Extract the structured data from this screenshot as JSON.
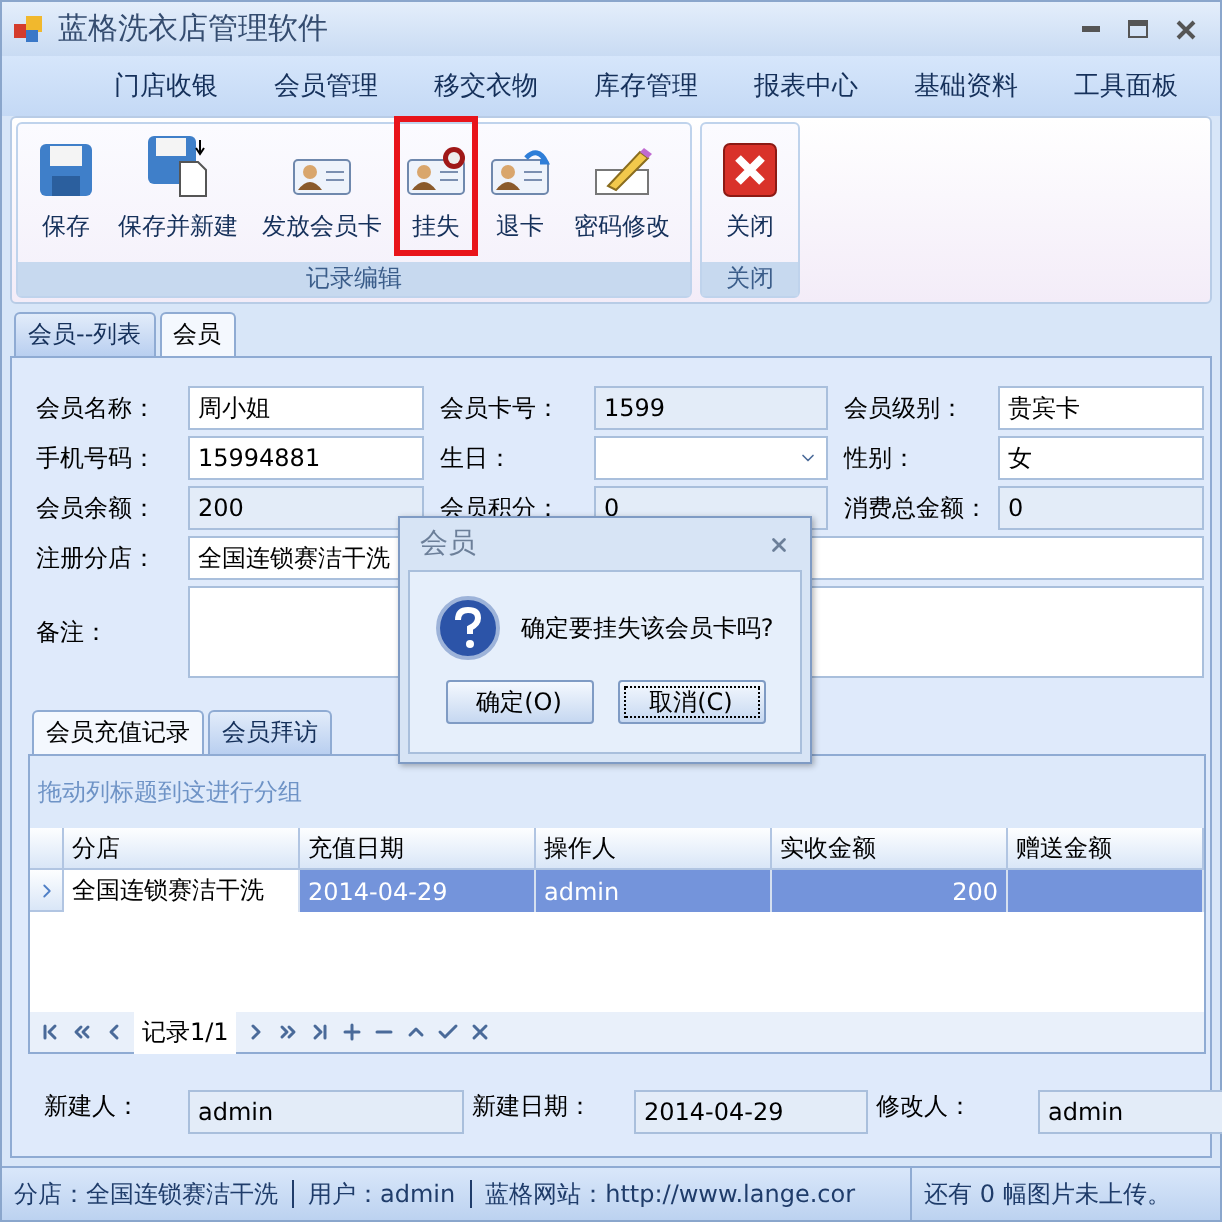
{
  "window": {
    "title": "蓝格洗衣店管理软件"
  },
  "menu": [
    "门店收银",
    "会员管理",
    "移交衣物",
    "库存管理",
    "报表中心",
    "基础资料",
    "工具面板"
  ],
  "ribbon": [
    {
      "label": "记录编辑",
      "buttons": [
        {
          "label": "保存",
          "kind": "save",
          "highlighted": false
        },
        {
          "label": "保存并新建",
          "kind": "save-new",
          "highlighted": false
        },
        {
          "label": "发放会员卡",
          "kind": "card",
          "highlighted": false
        },
        {
          "label": "挂失",
          "kind": "card-lost",
          "highlighted": true
        },
        {
          "label": "退卡",
          "kind": "card-return",
          "highlighted": false
        },
        {
          "label": "密码修改",
          "kind": "pencil",
          "highlighted": false
        }
      ]
    },
    {
      "label": "关闭",
      "buttons": [
        {
          "label": "关闭",
          "kind": "close",
          "highlighted": false
        }
      ]
    }
  ],
  "doc_tabs": [
    {
      "label": "会员--列表",
      "selected": false
    },
    {
      "label": "会员",
      "selected": true
    }
  ],
  "form": [
    {
      "label": "会员名称：",
      "value": "周小姐",
      "kind": "text",
      "readonly": false
    },
    {
      "label": "会员卡号：",
      "value": "1599",
      "kind": "text",
      "readonly": true
    },
    {
      "label": "会员级别：",
      "value": "贵宾卡",
      "kind": "text",
      "readonly": false
    },
    {
      "label": "手机号码：",
      "value": "15994881",
      "kind": "text",
      "readonly": false
    },
    {
      "label": "生日：",
      "kind": "dropdown",
      "readonly": false
    },
    {
      "label": "性别：",
      "value": "女",
      "kind": "text",
      "readonly": false
    },
    {
      "label": "会员余额：",
      "value": "200",
      "kind": "text",
      "readonly": true
    },
    {
      "label": "会员积分：",
      "value": "0",
      "kind": "text",
      "readonly": true
    },
    {
      "label": "消费总金额：",
      "value": "0",
      "kind": "text",
      "readonly": true
    },
    {
      "label": "注册分店：",
      "value": "全国连锁赛洁干洗",
      "kind": "wide",
      "readonly": false
    },
    {
      "label": "备注：",
      "kind": "memo",
      "readonly": false
    }
  ],
  "detail_tabs": [
    {
      "label": "会员充值记录",
      "selected": true
    },
    {
      "label": "会员拜访",
      "selected": false
    }
  ],
  "grid": {
    "group_hint": "拖动列标题到这进行分组",
    "columns": [
      {
        "label": "分店",
        "kind": "text"
      },
      {
        "label": "充值日期",
        "kind": "text"
      },
      {
        "label": "操作人",
        "kind": "text"
      },
      {
        "label": "实收金额",
        "kind": "number"
      },
      {
        "label": "赠送金额",
        "kind": "number"
      }
    ],
    "rows": [
      {
        "selected": true,
        "cells": [
          "全国连锁赛洁干洗",
          "2014-04-29",
          "admin",
          "200",
          ""
        ]
      }
    ],
    "navigator": "记录1/1"
  },
  "audit": [
    {
      "label": "新建人：",
      "value": "admin"
    },
    {
      "label": "新建日期：",
      "value": "2014-04-29"
    },
    {
      "label": "修改人：",
      "value": "admin"
    }
  ],
  "status_bar": {
    "items": [
      "分店：全国连锁赛洁干洗",
      "用户：admin",
      "蓝格网站：http://www.lange.cor"
    ],
    "right": "还有 0 幅图片未上传。"
  },
  "dialog": {
    "title": "会员",
    "message": "确定要挂失该会员卡吗?",
    "buttons": [
      {
        "label": "确定(O)",
        "focused": false
      },
      {
        "label": "取消(C)",
        "focused": true
      }
    ]
  }
}
